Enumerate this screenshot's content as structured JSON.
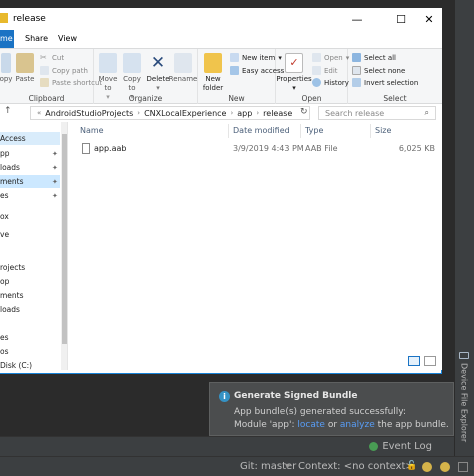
{
  "explorer": {
    "title": "release",
    "tabs": [
      {
        "label": "me"
      },
      {
        "label": "Share"
      },
      {
        "label": "View"
      }
    ],
    "ribbon": {
      "clipboard": {
        "label": "Clipboard",
        "copy": "opy",
        "paste": "Paste",
        "cut": "Cut",
        "copy_path": "Copy path",
        "paste_shortcut": "Paste shortcut"
      },
      "organize": {
        "label": "Organize",
        "move_to": "Move to",
        "copy_to": "Copy to",
        "delete": "Delete",
        "rename": "Rename"
      },
      "new": {
        "label": "New",
        "new_folder": "New folder",
        "new_item": "New item",
        "easy_access": "Easy access"
      },
      "open": {
        "label": "Open",
        "properties": "Properties",
        "open": "Open",
        "edit": "Edit",
        "history": "History"
      },
      "select": {
        "label": "Select",
        "select_all": "Select all",
        "select_none": "Select none",
        "invert_selection": "Invert selection"
      }
    },
    "address": {
      "crumbs": [
        "AndroidStudioProjects",
        "CNXLocalExperience",
        "app",
        "release"
      ],
      "search_placeholder": "Search release"
    },
    "nav": [
      {
        "label": "Access"
      },
      {
        "label": "pp"
      },
      {
        "label": "loads"
      },
      {
        "label": "ments"
      },
      {
        "label": "es"
      },
      {
        "label": "ox"
      },
      {
        "label": "ve"
      },
      {
        "label": "rojects"
      },
      {
        "label": "op"
      },
      {
        "label": "ments"
      },
      {
        "label": "loads"
      },
      {
        "label": "es"
      },
      {
        "label": "os"
      },
      {
        "label": "Disk (C:)"
      }
    ],
    "columns": {
      "name": "Name",
      "date": "Date modified",
      "type": "Type",
      "size": "Size"
    },
    "files": [
      {
        "name": "app.aab",
        "date": "3/9/2019 4:43 PM",
        "type": "AAB File",
        "size": "6,025 KB"
      }
    ]
  },
  "notification": {
    "title": "Generate Signed Bundle",
    "line1": "App bundle(s) generated successfully:",
    "line2_prefix": "Module 'app':",
    "locate": "locate",
    "or": "or",
    "analyze": "analyze",
    "line2_suffix": "the app bundle."
  },
  "side_tab": {
    "label": "Device File Explorer"
  },
  "statusbar": {
    "git": "Git: master",
    "context": "Context: <no context>",
    "event_log": "Event Log"
  }
}
